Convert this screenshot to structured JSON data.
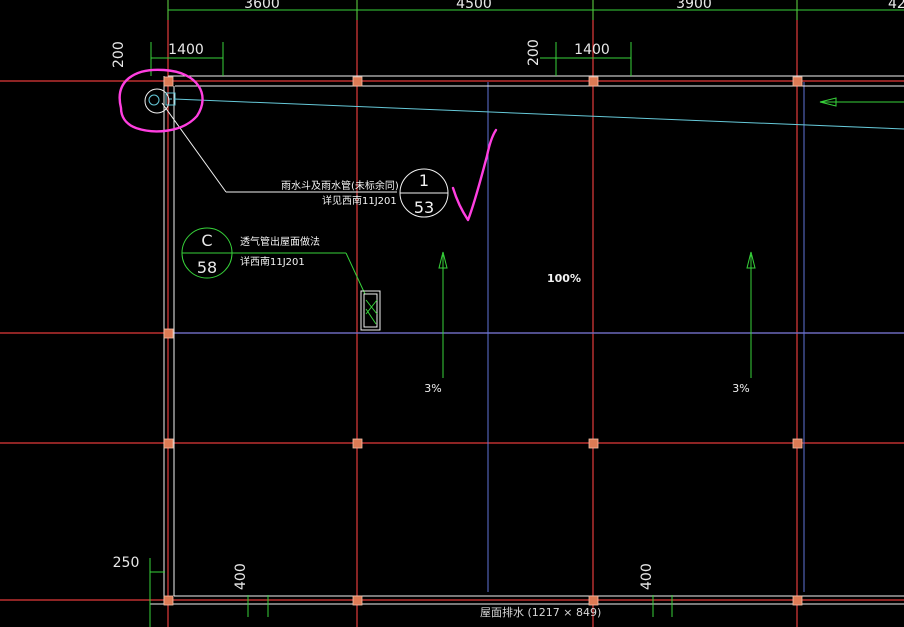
{
  "window": {
    "title": "屋面排水 (1217 × 849)"
  },
  "dimensions": {
    "top_spans": [
      "3600",
      "4500",
      "3900",
      "42"
    ],
    "local": {
      "d200_left": "200",
      "d1400_left": "1400",
      "d200_mid": "200",
      "d1400_mid": "1400",
      "d250": "250",
      "d400_left": "400",
      "d400_right": "400"
    }
  },
  "annotations": {
    "drain_label_line1": "雨水斗及雨水管(未标余同)",
    "drain_label_line2": "详见西南11J201",
    "drain_detail_top": "1",
    "drain_detail_bottom": "53",
    "vent_label_line1": "透气管出屋面做法",
    "vent_label_line2": "详西南11J201",
    "vent_detail_top": "C",
    "vent_detail_bottom": "58",
    "slope_left": "3%",
    "slope_right": "3%",
    "percent_center": "100%"
  },
  "status": {
    "text": "屋面排水 (1217 × 849)"
  },
  "colors": {
    "axis_red": "#e23b3b",
    "wall_white": "#f2f2f2",
    "dim_green": "#37d23a",
    "blue": "#5f74d8",
    "cyan": "#66c9d9",
    "magenta": "#ff3fe0",
    "column_orange": "#dd7b55"
  }
}
